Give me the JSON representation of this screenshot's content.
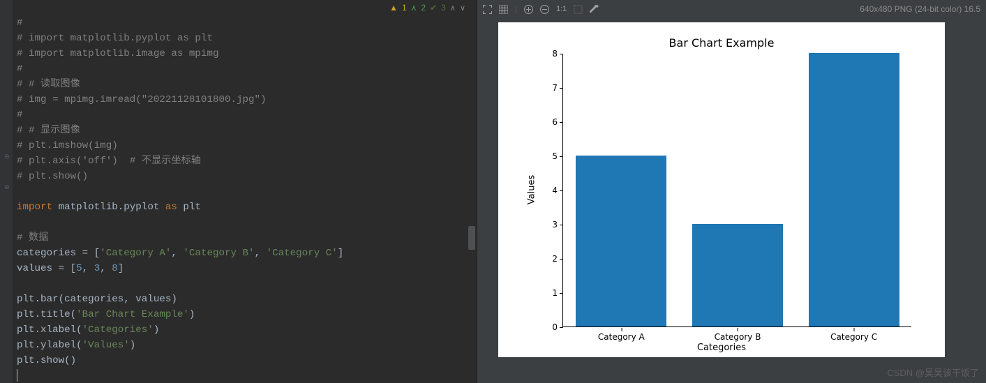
{
  "inspections": {
    "warn": "1",
    "info": "2",
    "weak": "3"
  },
  "code": {
    "l1": "#",
    "l2": "# import matplotlib.pyplot as plt",
    "l3": "# import matplotlib.image as mpimg",
    "l4": "#",
    "l5": "# # 读取图像",
    "l6": "# img = mpimg.imread(\"20221128101800.jpg\")",
    "l7": "#",
    "l8": "# # 显示图像",
    "l9": "# plt.imshow(img)",
    "l10": "# plt.axis('off')  # 不显示坐标轴",
    "l11": "# plt.show()",
    "kw_import": "import",
    "mod_mpl": " matplotlib.pyplot ",
    "kw_as": "as",
    "mod_plt": " plt",
    "cm_data": "# 数据",
    "id_cat": "categories = [",
    "s_ca": "'Category A'",
    "sep": ", ",
    "s_cb": "'Category B'",
    "s_cc": "'Category C'",
    "close_br": "]",
    "id_val": "values = [",
    "n5": "5",
    "n3": "3",
    "n8": "8",
    "pl_bar": "plt.bar(categories",
    "pl_bar2": " values)",
    "pl_title_a": "plt.title(",
    "s_title": "'Bar Chart Example'",
    "paren_close": ")",
    "pl_xl_a": "plt.xlabel(",
    "s_xl": "'Categories'",
    "pl_yl_a": "plt.ylabel(",
    "s_yl": "'Values'",
    "pl_show": "plt.show()"
  },
  "viewer": {
    "oneToOne": "1:1",
    "info": "640x480 PNG (24-bit color) 16.5"
  },
  "chart_data": {
    "type": "bar",
    "title": "Bar Chart Example",
    "xlabel": "Categories",
    "ylabel": "Values",
    "categories": [
      "Category A",
      "Category B",
      "Category C"
    ],
    "values": [
      5,
      3,
      8
    ],
    "ylim": [
      0,
      8
    ],
    "yticks": [
      0,
      1,
      2,
      3,
      4,
      5,
      6,
      7,
      8
    ]
  },
  "watermark": "CSDN @昊昊该干饭了"
}
